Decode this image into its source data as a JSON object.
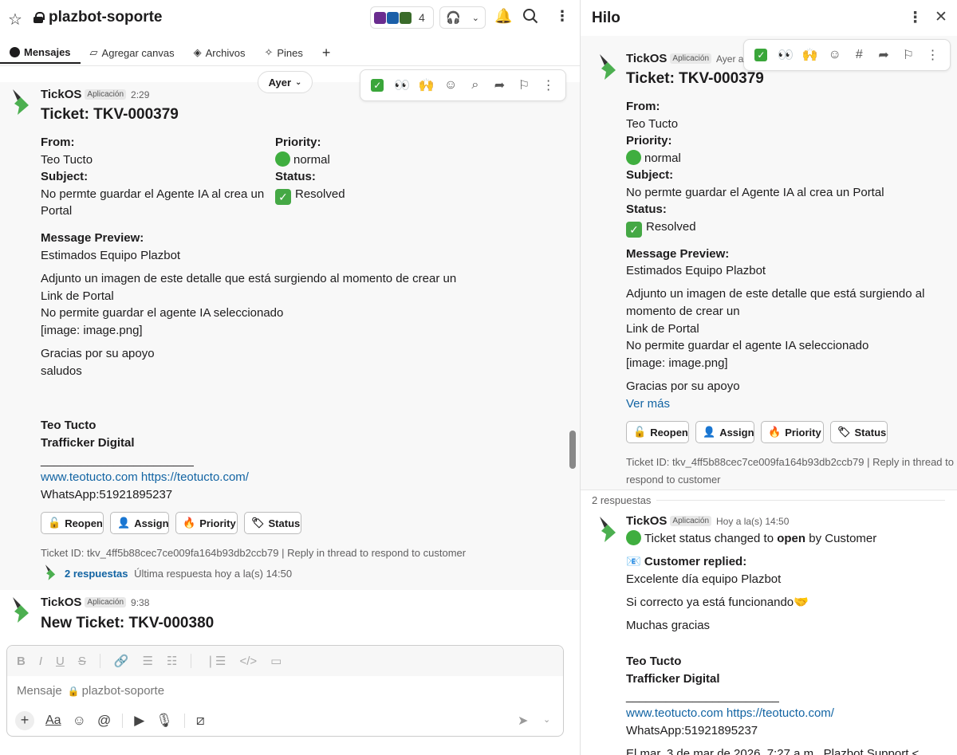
{
  "header": {
    "channel": "plazbot-soporte",
    "member_count": "4"
  },
  "tabs": [
    {
      "label": "Mensajes"
    },
    {
      "label": "Agregar canvas"
    },
    {
      "label": "Archivos"
    },
    {
      "label": "Pines"
    }
  ],
  "day_pill": "Ayer",
  "msg1": {
    "sender": "TickOS",
    "tag": "Aplicación",
    "time": "2:29",
    "title": "Ticket: TKV-000379",
    "from_label": "From:",
    "from_value": "Teo Tucto",
    "priority_label": "Priority:",
    "priority_value": "normal",
    "subject_label": "Subject:",
    "subject_line1": "No permte guardar el Agente IA al crea un",
    "subject_line2": "Portal",
    "status_label": "Status:",
    "status_value": "Resolved",
    "preview_label": "Message Preview:",
    "preview_greet": "Estimados Equipo Plazbot",
    "body1": "Adjunto un imagen de este detalle que está surgiendo al momento de crear un",
    "body2": "Link de Portal",
    "body3": "No permite guardar el agente IA seleccionado",
    "body4": "[image: image.png]",
    "thanks": "Gracias por su apoyo",
    "bye": "saludos",
    "sig_name": "Teo Tucto",
    "sig_role": "Trafficker Digital",
    "sig_rule": "_______________________",
    "sig_link1": "www.teotucto.com",
    "sig_link2": "https://teotucto.com/",
    "sig_whatsapp": "WhatsApp:51921895237",
    "buttons": [
      "Reopen",
      "Assign",
      "Priority",
      "Status"
    ],
    "ticket_footer": "Ticket ID: tkv_4ff5b88cec7ce009fa164b93db2ccb79 | Reply in thread to respond to customer",
    "replies": "2 respuestas",
    "last_reply": "Última respuesta hoy a la(s) 14:50"
  },
  "msg2": {
    "sender": "TickOS",
    "tag": "Aplicación",
    "time": "9:38",
    "title": "New Ticket: TKV-000380"
  },
  "composer": {
    "placeholder": "Mensaje",
    "channel": "plazbot-soporte"
  },
  "thread": {
    "title": "Hilo",
    "parent": {
      "sender": "TickOS",
      "tag": "Aplicación",
      "time": "Ayer a",
      "title": "Ticket: TKV-000379",
      "from_label": "From:",
      "from_value": "Teo Tucto",
      "priority_label": "Priority:",
      "priority_value": "normal",
      "subject_label": "Subject:",
      "subject_value": "No permte guardar el Agente IA al crea un Portal",
      "status_label": "Status:",
      "status_value": "Resolved",
      "preview_label": "Message Preview:",
      "preview_greet": "Estimados Equipo Plazbot",
      "body1": "Adjunto un imagen de este detalle que está surgiendo al",
      "body2": "momento de crear un",
      "body3": "Link de Portal",
      "body4": "No permite guardar el agente IA seleccionado",
      "body5": "[image: image.png]",
      "thanks": "Gracias por su apoyo",
      "more": "Ver más",
      "buttons": [
        "Reopen",
        "Assign",
        "Priority",
        "Status"
      ],
      "footer1": "Ticket ID: tkv_4ff5b88cec7ce009fa164b93db2ccb79 | Reply in thread to",
      "footer2": "respond to customer"
    },
    "reply_count": "2 respuestas",
    "reply": {
      "sender": "TickOS",
      "tag": "Aplicación",
      "time": "Hoy a la(s) 14:50",
      "status_pre": "Ticket status changed to",
      "status_word": "open",
      "status_post": "by Customer",
      "replied_label": "Customer replied:",
      "line1": "Excelente día equipo Plazbot",
      "line2": "Si correcto ya está funcionando",
      "line3": "Muchas gracias",
      "sig_name": "Teo Tucto",
      "sig_role": "Trafficker Digital",
      "sig_rule": "_______________________",
      "sig_link1": "www.teotucto.com",
      "sig_link2": "https://teotucto.com/",
      "sig_whatsapp": "WhatsApp:51921895237",
      "cut_line": "El mar, 3 de mar de 2026, 7:27 a.m., Plazbot Support <"
    }
  },
  "colors": {
    "link": "#1264a3",
    "status_green": "#3fae3f",
    "logo_dark": "#333333",
    "logo_green": "#4caf50"
  }
}
